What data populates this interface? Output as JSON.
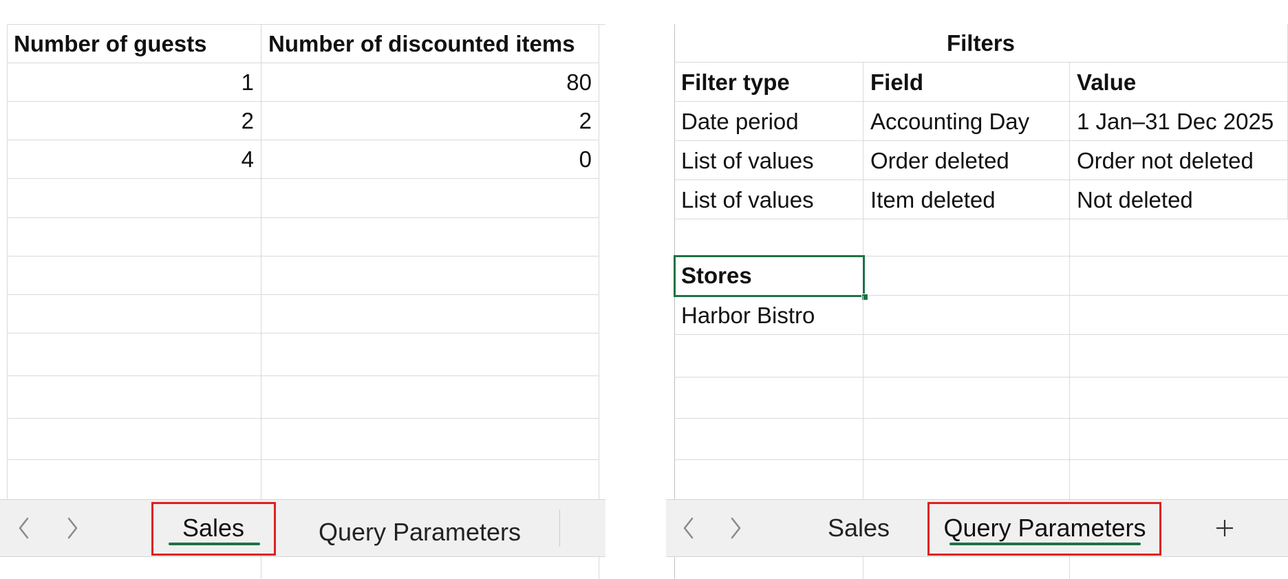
{
  "left_pane": {
    "headers": [
      "Number of guests",
      "Number of discounted items"
    ],
    "rows": [
      [
        "1",
        "80"
      ],
      [
        "2",
        "2"
      ],
      [
        "4",
        "0"
      ]
    ],
    "tabs": [
      "Sales",
      "Query Parameters"
    ],
    "active_tab": "Sales",
    "highlighted_tab": "Sales"
  },
  "right_pane": {
    "title": "Filters",
    "headers": [
      "Filter type",
      "Field",
      "Value"
    ],
    "rows": [
      [
        "Date period",
        "Accounting Day",
        "1 Jan–31 Dec 2025"
      ],
      [
        "List of values",
        "Order deleted",
        "Order not deleted"
      ],
      [
        "List of values",
        "Item deleted",
        "Not deleted"
      ]
    ],
    "stores_header": "Stores",
    "stores": [
      "Harbor Bistro"
    ],
    "selected_cell": "Stores",
    "tabs": [
      "Sales",
      "Query Parameters"
    ],
    "active_tab": "Query Parameters",
    "highlighted_tab": "Query Parameters",
    "add_sheet_icon": "plus-icon"
  },
  "icons": {
    "prev": "chevron-left-icon",
    "next": "chevron-right-icon"
  },
  "colors": {
    "active_tab_underline": "#1f7244",
    "selection_border": "#1f7244",
    "highlight_box": "#e02020",
    "gridline": "#d9d9d9",
    "tabbar_background": "#f0f0f0"
  }
}
